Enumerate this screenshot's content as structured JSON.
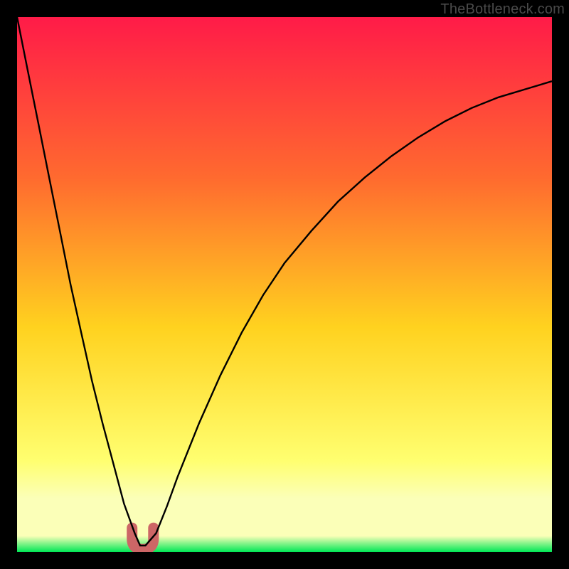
{
  "attribution": "TheBottleneck.com",
  "colors": {
    "page_bg": "#000000",
    "gradient_top": "#ff1b48",
    "gradient_mid1": "#ff6a2f",
    "gradient_mid2": "#ffd21f",
    "gradient_low": "#ffff70",
    "gradient_band": "#fbffb8",
    "gradient_bottom": "#00e756",
    "curve": "#000000",
    "dip_marker": "#cc6666"
  },
  "chart_data": {
    "type": "line",
    "title": "",
    "xlabel": "",
    "ylabel": "",
    "xlim": [
      0,
      100
    ],
    "ylim": [
      0,
      100
    ],
    "series": [
      {
        "name": "bottleneck-curve",
        "x": [
          0,
          2,
          4,
          6,
          8,
          10,
          12,
          14,
          16,
          18,
          20,
          22,
          23,
          24,
          26,
          28,
          30,
          34,
          38,
          42,
          46,
          50,
          55,
          60,
          65,
          70,
          75,
          80,
          85,
          90,
          95,
          100
        ],
        "y": [
          100,
          90,
          80,
          70,
          60,
          50,
          41,
          32,
          24,
          16.5,
          9,
          3.5,
          1.2,
          1.2,
          3.5,
          8.5,
          14,
          24,
          33,
          41,
          48,
          54,
          60,
          65.5,
          70,
          74,
          77.5,
          80.5,
          83,
          85,
          86.5,
          88
        ]
      }
    ],
    "annotations": [
      {
        "name": "dip-marker",
        "shape": "U",
        "x_range": [
          21.5,
          25.5
        ],
        "y_range": [
          0.5,
          4.5
        ]
      }
    ],
    "legend": false,
    "grid": false
  }
}
